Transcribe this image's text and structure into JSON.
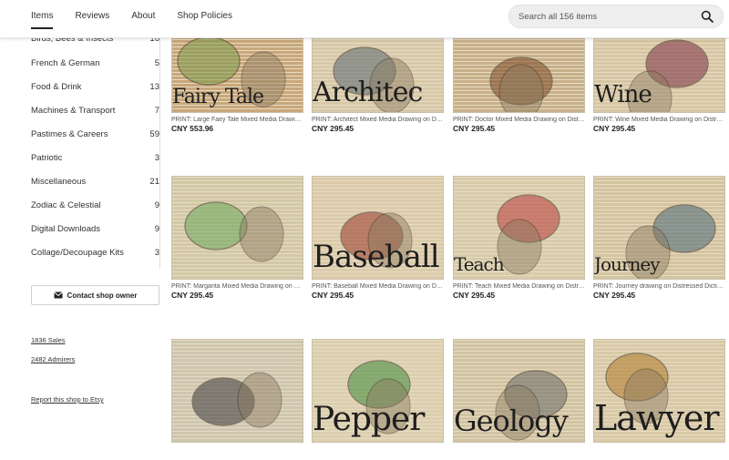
{
  "nav": {
    "tabs": [
      {
        "label": "Items",
        "active": true
      },
      {
        "label": "Reviews"
      },
      {
        "label": "About"
      },
      {
        "label": "Shop Policies"
      }
    ],
    "search_placeholder": "Search all 156 items"
  },
  "sidebar": {
    "categories": [
      {
        "label": "Birds, Bees & Insects",
        "count": "16"
      },
      {
        "label": "French & German",
        "count": "5"
      },
      {
        "label": "Food & Drink",
        "count": "13"
      },
      {
        "label": "Machines & Transport",
        "count": "7"
      },
      {
        "label": "Pastimes & Careers",
        "count": "59"
      },
      {
        "label": "Patriotic",
        "count": "3"
      },
      {
        "label": "Miscellaneous",
        "count": "21"
      },
      {
        "label": "Zodiac & Celestial",
        "count": "9"
      },
      {
        "label": "Digital Downloads",
        "count": "9"
      },
      {
        "label": "Collage/Decoupage Kits",
        "count": "3"
      }
    ],
    "contact_label": "Contact shop owner",
    "sales": "1836 Sales",
    "admirers": "2482 Admirers",
    "report": "Report this shop to Etsy"
  },
  "listings": [
    {
      "title": "PRINT: Large Fairy Tale Mixed Media Drawing on Distressed Dictionary",
      "price": "CNY 553.96",
      "word": "Fairy Tale",
      "tone": "#c9a77a",
      "accent": "#7a9a4a"
    },
    {
      "title": "PRINT: Architect Mixed Media Drawing on Distressed Dictionary",
      "price": "CNY 295.45",
      "word": "Architec",
      "tone": "#d7c8a8",
      "accent": "#5a6b72"
    },
    {
      "title": "PRINT: Doctor Mixed Media Drawing on Distressed Dictionary",
      "price": "CNY 295.45",
      "word": "",
      "tone": "#c9b08a",
      "accent": "#7b4a26"
    },
    {
      "title": "PRINT: Wine Mixed Media Drawing on Distressed Dictionary",
      "price": "CNY 295.45",
      "word": "Wine",
      "tone": "#d8c6a4",
      "accent": "#7a2f44"
    },
    {
      "title": "PRINT: Margarita Mixed Media Drawing on Distressed Dictionary",
      "price": "CNY 295.45",
      "word": "",
      "tone": "#d3c8a6",
      "accent": "#6aa85a"
    },
    {
      "title": "PRINT: Baseball Mixed Media Drawing on Distressed Dictionary",
      "price": "CNY 295.45",
      "word": "Baseball",
      "tone": "#dccbaa",
      "accent": "#9a3a2a"
    },
    {
      "title": "PRINT: Teach Mixed Media Drawing on Distressed Dictionary",
      "price": "CNY 295.45",
      "word": "Teach",
      "tone": "#d8cba9",
      "accent": "#b83a3a"
    },
    {
      "title": "PRINT: Journey drawing on Distressed Dictionary",
      "price": "CNY 295.45",
      "word": "Journey",
      "tone": "#d4c4a0",
      "accent": "#4b6a7a"
    },
    {
      "title": "",
      "price": "",
      "word": "",
      "tone": "#cfc6b0",
      "accent": "#3c3c3c"
    },
    {
      "title": "",
      "price": "",
      "word": "Pepper",
      "tone": "#dccfae",
      "accent": "#3f8a3a"
    },
    {
      "title": "",
      "price": "",
      "word": "Geology",
      "tone": "#d2c4a2",
      "accent": "#6a6a6a"
    },
    {
      "title": "",
      "price": "",
      "word": "Lawyer",
      "tone": "#d9c9a6",
      "accent": "#b07a2a"
    }
  ]
}
